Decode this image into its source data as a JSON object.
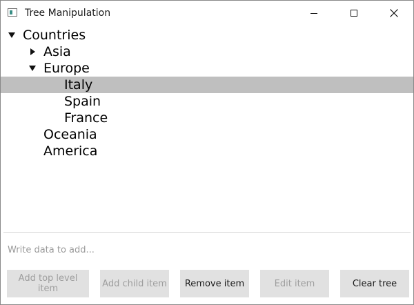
{
  "window": {
    "title": "Tree Manipulation",
    "icon": "app-window-icon"
  },
  "tree": {
    "items": [
      {
        "label": "Countries",
        "level": 0,
        "expanded": true
      },
      {
        "label": "Asia",
        "level": 1,
        "expanded": false
      },
      {
        "label": "Europe",
        "level": 1,
        "expanded": true
      },
      {
        "label": "Italy",
        "level": 2,
        "selected": true
      },
      {
        "label": "Spain",
        "level": 2
      },
      {
        "label": "France",
        "level": 2
      },
      {
        "label": "Oceania",
        "level": 1
      },
      {
        "label": "America",
        "level": 1
      }
    ]
  },
  "input": {
    "value": "",
    "placeholder": "Write data to add..."
  },
  "buttons": {
    "add_top_level": "Add top level item",
    "add_child": "Add child item",
    "remove": "Remove item",
    "edit": "Edit item",
    "clear": "Clear tree"
  },
  "colors": {
    "selection": "#bfbfbf",
    "button_bg": "#e1e1e1",
    "disabled_text": "#9e9e9e",
    "placeholder_text": "#9a9a9a"
  }
}
